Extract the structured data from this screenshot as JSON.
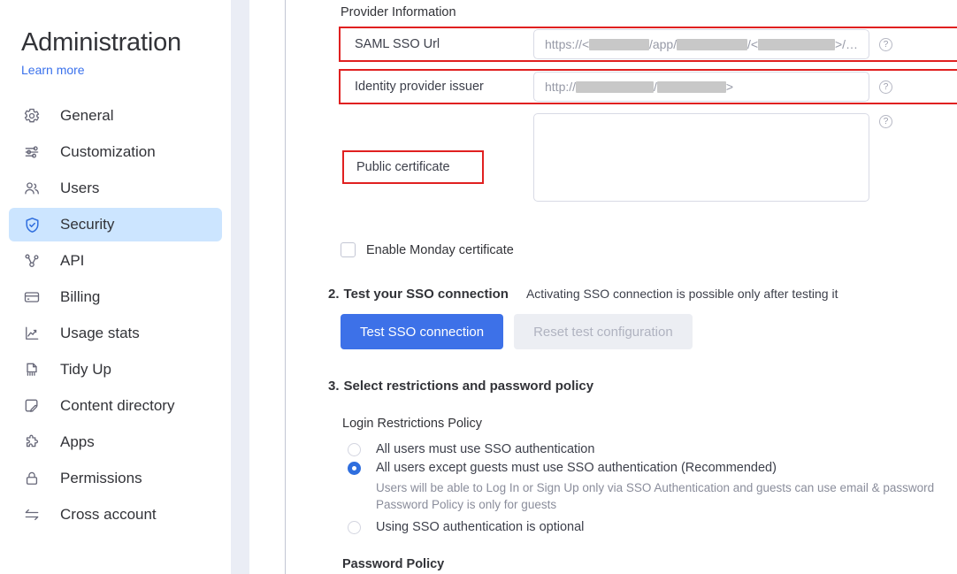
{
  "sidebar": {
    "title": "Administration",
    "learn_more": "Learn more",
    "items": [
      {
        "label": "General",
        "icon": "gear-icon",
        "active": false
      },
      {
        "label": "Customization",
        "icon": "sliders-icon",
        "active": false
      },
      {
        "label": "Users",
        "icon": "users-icon",
        "active": false
      },
      {
        "label": "Security",
        "icon": "shield-check-icon",
        "active": true
      },
      {
        "label": "API",
        "icon": "api-nodes-icon",
        "active": false
      },
      {
        "label": "Billing",
        "icon": "credit-card-icon",
        "active": false
      },
      {
        "label": "Usage stats",
        "icon": "chart-line-icon",
        "active": false
      },
      {
        "label": "Tidy Up",
        "icon": "broom-icon",
        "active": false
      },
      {
        "label": "Content directory",
        "icon": "document-edit-icon",
        "active": false
      },
      {
        "label": "Apps",
        "icon": "puzzle-icon",
        "active": false
      },
      {
        "label": "Permissions",
        "icon": "lock-icon",
        "active": false
      },
      {
        "label": "Cross account",
        "icon": "transfer-arrows-icon",
        "active": false
      }
    ]
  },
  "main": {
    "provider_information_label": "Provider Information",
    "fields": [
      {
        "label": "SAML SSO Url",
        "value_prefix": "https://<",
        "value_parts": [
          "/app/",
          "/<",
          ">/…"
        ],
        "redaction_widths": [
          78,
          92,
          100
        ],
        "help_icon": "help-circle-icon"
      },
      {
        "label": "Identity provider issuer",
        "value_prefix": "http://",
        "value_parts": [
          "/",
          ">"
        ],
        "redaction_widths": [
          88,
          78
        ],
        "help_icon": "help-circle-icon"
      }
    ],
    "public_certificate_label": "Public certificate",
    "public_certificate_value": "",
    "certificate_help_icon": "help-circle-icon",
    "enable_monday_certificate_label": "Enable Monday certificate",
    "enable_monday_certificate_checked": false,
    "step2": {
      "number": "2.",
      "title": "Test your SSO connection",
      "note": "Activating SSO connection is possible only after testing it",
      "primary_button": "Test SSO connection",
      "secondary_button": "Reset test configuration",
      "secondary_disabled": true
    },
    "step3": {
      "number": "3.",
      "title": "Select restrictions and password policy",
      "login_restrictions_label": "Login Restrictions Policy",
      "options": [
        {
          "label": "All users must use SSO authentication",
          "selected": false,
          "description": null
        },
        {
          "label": "All users except guests must use SSO authentication (Recommended)",
          "selected": true,
          "description": "Users will be able to Log In or Sign Up only via SSO Authentication and guests can use email & password\nPassword Policy is only for guests"
        },
        {
          "label": "Using SSO authentication is optional",
          "selected": false,
          "description": null
        }
      ],
      "password_policy_label": "Password Policy"
    }
  },
  "colors": {
    "accent_blue": "#3d71e8",
    "sidebar_active_bg": "#cce5ff",
    "highlight_red": "#e02020",
    "rail_grey": "#eaedf5",
    "disabled_grey": "#eceef3"
  }
}
